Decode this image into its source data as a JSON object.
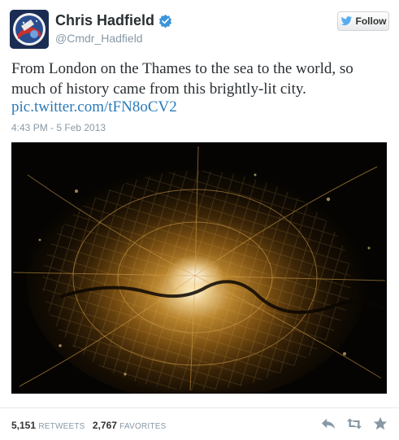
{
  "user": {
    "display_name": "Chris Hadfield",
    "handle": "@Cmdr_Hadfield"
  },
  "follow_button": {
    "label": "Follow"
  },
  "tweet": {
    "text": "From London on the Thames to the sea to the world, so much of history came from this brightly-lit city.",
    "link": "pic.twitter.com/tFN8oCV2",
    "timestamp": "4:43 PM - 5 Feb 2013"
  },
  "stats": {
    "retweets_count": "5,151",
    "retweets_label": "RETWEETS",
    "favorites_count": "2,767",
    "favorites_label": "FAVORITES"
  },
  "icons": {
    "verified": "verified-badge-icon",
    "bird": "twitter-bird-icon",
    "reply": "reply-icon",
    "retweet": "retweet-icon",
    "favorite": "star-icon"
  },
  "colors": {
    "link": "#2a7ab8",
    "verified": "#3b94d9",
    "bird": "#55acee",
    "muted": "#8899a6"
  }
}
